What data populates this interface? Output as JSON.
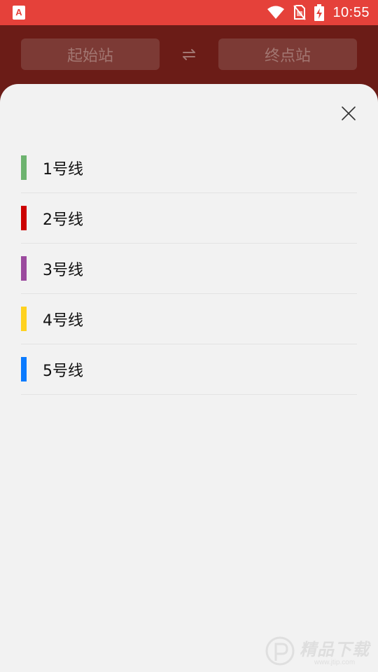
{
  "status_bar": {
    "time": "10:55",
    "app_icon_letter": "A",
    "icons": [
      "app-icon",
      "wifi-icon",
      "no-sim-icon",
      "battery-charging-icon"
    ]
  },
  "header": {
    "start_station_label": "起始站",
    "end_station_label": "终点站",
    "swap_icon": "swap-icon"
  },
  "sheet": {
    "close_icon": "close-icon",
    "lines": [
      {
        "name": "1号线",
        "color": "#6db36f"
      },
      {
        "name": "2号线",
        "color": "#cc0000"
      },
      {
        "name": "3号线",
        "color": "#9b4a9e"
      },
      {
        "name": "4号线",
        "color": "#ffd21f"
      },
      {
        "name": "5号线",
        "color": "#0a7bff"
      }
    ]
  },
  "watermark": {
    "text": "精品下载",
    "sub_text": "www.jtip.com"
  },
  "colors": {
    "status_bar": "#e5413a",
    "header_dimmed": "#6b1c17",
    "sheet_background": "#f2f2f2"
  }
}
